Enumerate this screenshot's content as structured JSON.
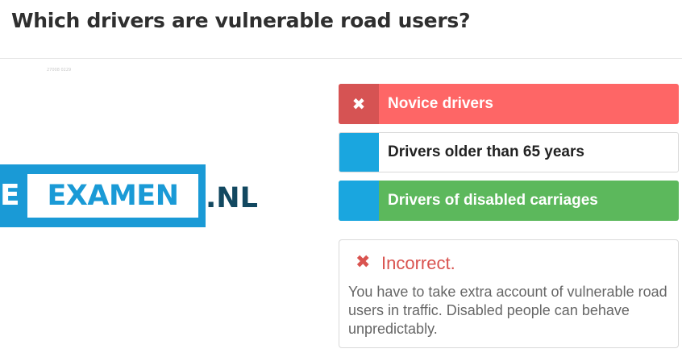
{
  "question": {
    "title": "Which drivers are vulnerable road users?"
  },
  "image": {
    "caption": "27008 0229",
    "logo": {
      "prefix": "E",
      "word": "EXAMEN",
      "tld": ".NL"
    }
  },
  "answers": [
    {
      "label": "Novice drivers",
      "state": "incorrect-selected",
      "icon": "close-icon"
    },
    {
      "label": "Drivers older than 65 years",
      "state": "unselected"
    },
    {
      "label": "Drivers of disabled carriages",
      "state": "correct"
    }
  ],
  "feedback": {
    "icon": "close-icon",
    "title": "Incorrect.",
    "text": "You have to take extra account of vulnerable road users in traffic. Disabled people can behave unpredictably."
  },
  "colors": {
    "wrong": "#fe6666",
    "wrong_marker": "#d65353",
    "correct": "#5cb85c",
    "accent_blue": "#1aa6df",
    "feedback_red": "#d9534f",
    "logo_dark": "#124860"
  }
}
